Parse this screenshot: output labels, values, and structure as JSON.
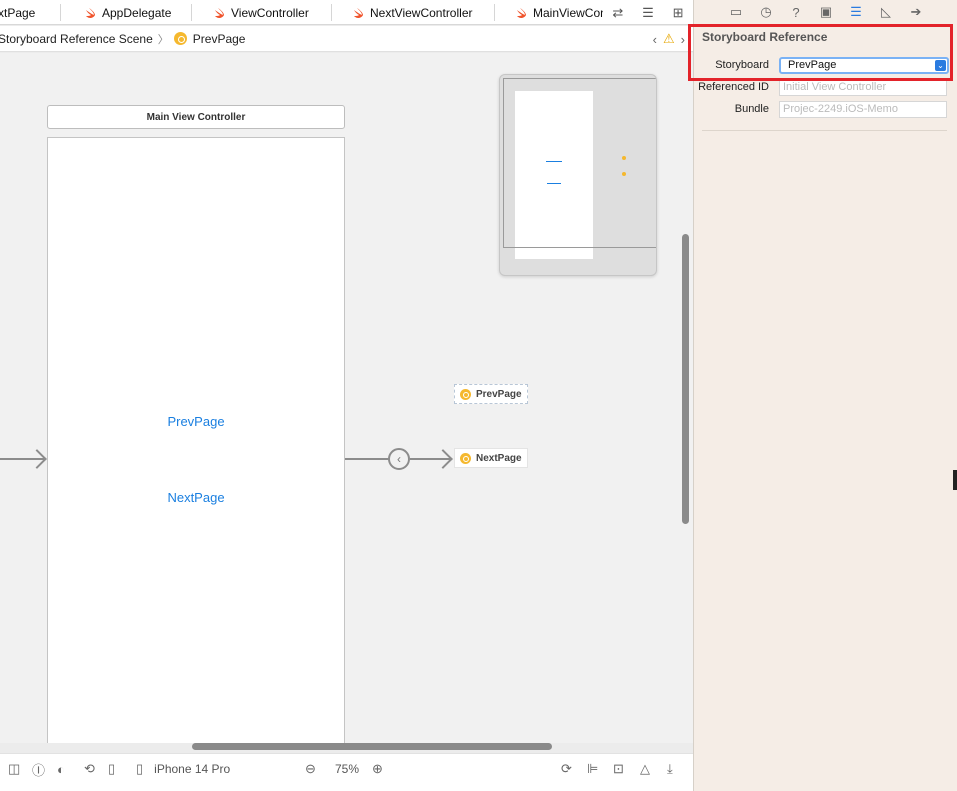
{
  "tabs": [
    {
      "label": "xtPage"
    },
    {
      "label": "AppDelegate"
    },
    {
      "label": "ViewController"
    },
    {
      "label": "NextViewController"
    },
    {
      "label": "MainViewCon"
    }
  ],
  "jumpbar": {
    "scene": "Storyboard Reference Scene",
    "item": "PrevPage"
  },
  "canvas": {
    "scene_title": "Main View Controller",
    "labels": [
      "PrevPage",
      "NextPage"
    ],
    "refs": [
      "PrevPage",
      "NextPage"
    ]
  },
  "bottombar": {
    "device": "iPhone 14 Pro",
    "zoom": "75%"
  },
  "inspector": {
    "section_title": "Storyboard Reference",
    "storyboard_label": "Storyboard",
    "storyboard_value": "PrevPage",
    "referenced_id_label": "Referenced ID",
    "referenced_id_placeholder": "Initial View Controller",
    "bundle_label": "Bundle",
    "bundle_placeholder": "Projec-2249.iOS-Memo"
  },
  "colors": {
    "accent": "#2a7be0",
    "link_text": "#1a7fe0",
    "storyboard_ref": "#f5b82e",
    "highlight": "#e3232a"
  }
}
